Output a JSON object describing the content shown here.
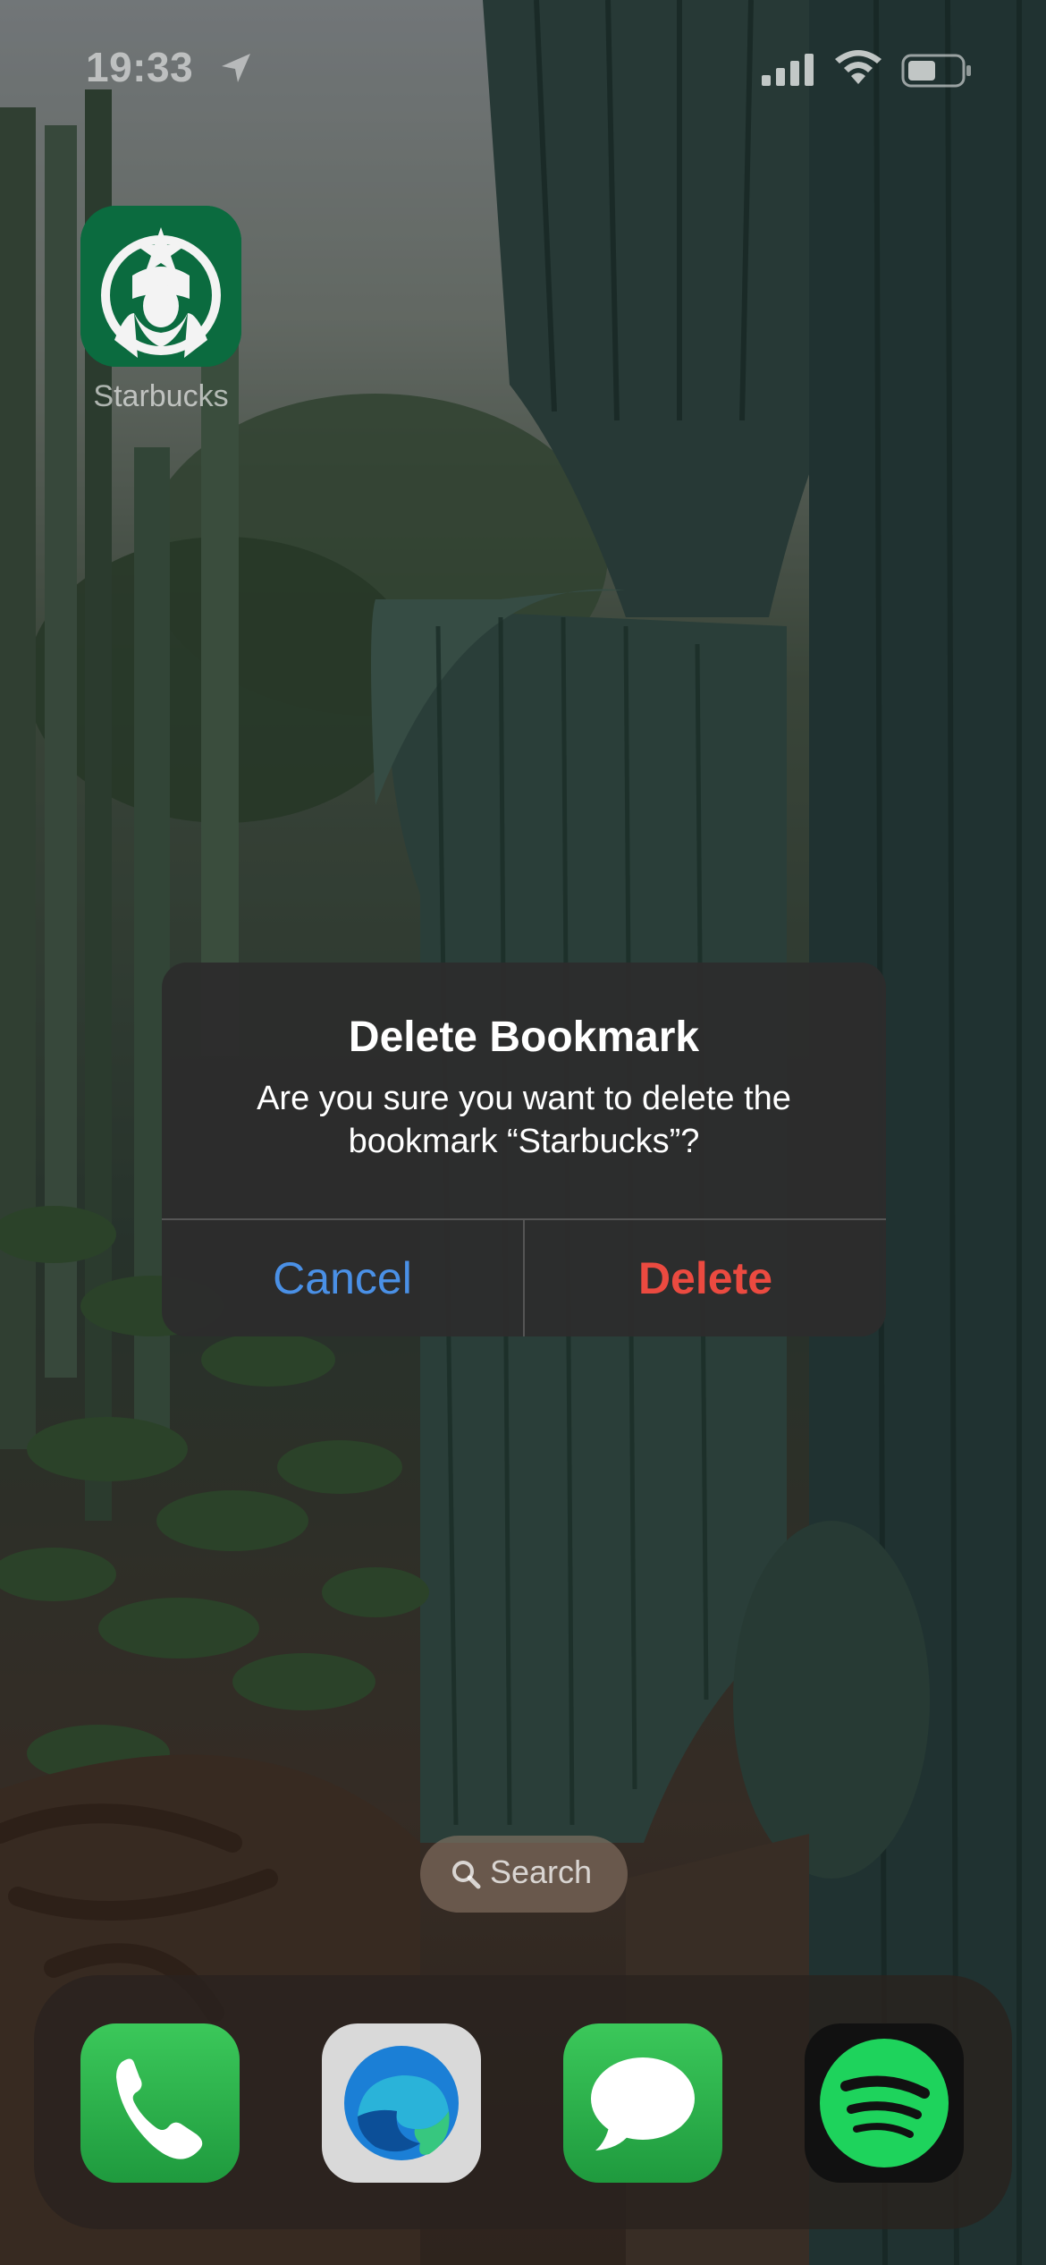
{
  "status_bar": {
    "time": "19:33",
    "location_icon": "location-arrow-icon",
    "signal_icon": "cellular-signal-icon",
    "wifi_icon": "wifi-icon",
    "battery_icon": "battery-icon"
  },
  "home_screen": {
    "apps": [
      {
        "label": "Starbucks",
        "icon": "starbucks-siren-icon"
      }
    ],
    "search": {
      "label": "Search",
      "icon": "search-icon"
    }
  },
  "alert": {
    "title": "Delete Bookmark",
    "message_line1": "Are you sure you want to delete the",
    "message_line2": "bookmark “Starbucks”?",
    "cancel_label": "Cancel",
    "delete_label": "Delete",
    "colors": {
      "cancel": "#4a90e6",
      "delete": "#eb4a40"
    }
  },
  "dock": {
    "apps": [
      {
        "name": "Phone",
        "icon": "phone-icon"
      },
      {
        "name": "Microsoft Edge",
        "icon": "edge-icon"
      },
      {
        "name": "Messages",
        "icon": "messages-icon"
      },
      {
        "name": "Spotify",
        "icon": "spotify-icon"
      }
    ]
  }
}
